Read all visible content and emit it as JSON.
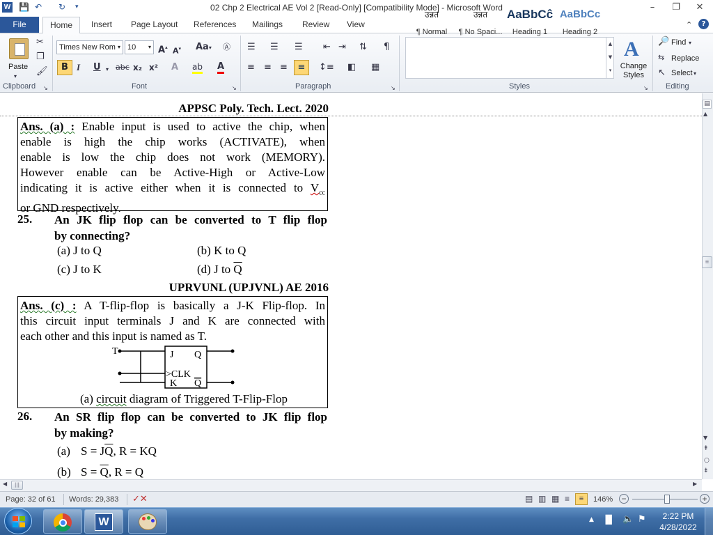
{
  "window": {
    "app_letter": "W",
    "title": "02 Chp 2 Electrical AE Vol 2 [Read-Only] [Compatibility Mode] - Microsoft Word"
  },
  "tabs": {
    "file": "File",
    "items": [
      "Home",
      "Insert",
      "Page Layout",
      "References",
      "Mailings",
      "Review",
      "View"
    ]
  },
  "ribbon": {
    "clipboard": {
      "paste": "Paste",
      "label": "Clipboard"
    },
    "font": {
      "name": "Times New Rom",
      "size": "10",
      "change_case": "Aa",
      "label": "Font",
      "bold": "B",
      "italic": "I",
      "underline": "U",
      "strike": "abc",
      "subscript": "x₂",
      "superscript": "x²"
    },
    "paragraph": {
      "label": "Paragraph"
    },
    "styles": {
      "label": "Styles",
      "items": [
        {
          "preview": "उन्नत",
          "name": "¶ Normal"
        },
        {
          "preview": "उन्नत",
          "name": "¶ No Spaci..."
        },
        {
          "preview": "AaBbCĉ",
          "name": "Heading 1"
        },
        {
          "preview": "AaBbCc",
          "name": "Heading 2"
        }
      ],
      "change_styles": "Change Styles"
    },
    "editing": {
      "find": "Find",
      "replace": "Replace",
      "select": "Select",
      "label": "Editing"
    }
  },
  "document": {
    "hdr1": "APPSC Poly. Tech. Lect. 2020",
    "ans24_lines": [
      "Enable input is used to active the chip, when",
      "enable is high the chip works (ACTIVATE), when",
      "enable is low the chip does not work (MEMORY).",
      "However enable can be Active-High or Active-Low",
      "indicating it is active either when it is connected to"
    ],
    "ans24_label": "Ans. (a) :",
    "ans24_vcc": "V",
    "ans24_vcc_sub": "cc",
    "ans24_last": "or GND respectively.",
    "q25_num": "25.",
    "q25_line1": "An JK flip flop can be converted to T flip flop",
    "q25_line2": "by connecting?",
    "q25_opts": {
      "a": "(a)  J to Q",
      "b": "(b)  K to Q",
      "c": "(c)  J to K",
      "d_pre": "(d)  J to ",
      "d_q": "Q"
    },
    "hdr2": "UPRVUNL (UPJVNL) AE 2016",
    "ans25_label": "Ans. (c) :",
    "ans25_lines": [
      "A T-flip-flop is basically a J-K Flip-flop. In",
      "this circuit input terminals J and K are connected with"
    ],
    "ans25_last": "each other and this input is named as T.",
    "diagram": {
      "t": "T",
      "j": "J",
      "q": "Q",
      "clk": ">CLK",
      "k": "K",
      "qbar": "Q"
    },
    "caption_pre": "(a) ",
    "caption_word": "circuit",
    "caption_post": " diagram of Triggered T-Flip-Flop",
    "q26_num": "26.",
    "q26_line1": "An SR flip flop can be converted to JK flip flop",
    "q26_line2": "by making?",
    "q26_opt_a_label": "(a)",
    "q26_opt_a": {
      "s": "S = J",
      "q": "Q",
      "r": ",   R = KQ"
    },
    "q26_opt_b_label": "(b)",
    "q26_opt_b": {
      "s": "S = ",
      "q": "Q",
      "r": ", R = Q"
    }
  },
  "status": {
    "page": "Page: 32 of 61",
    "words": "Words: 29,383",
    "zoom": "146%"
  },
  "taskbar": {
    "time": "2:22 PM",
    "date": "4/28/2022"
  },
  "colors": {
    "accent": "#2b579a",
    "taskbar": "#3f6ea6"
  }
}
